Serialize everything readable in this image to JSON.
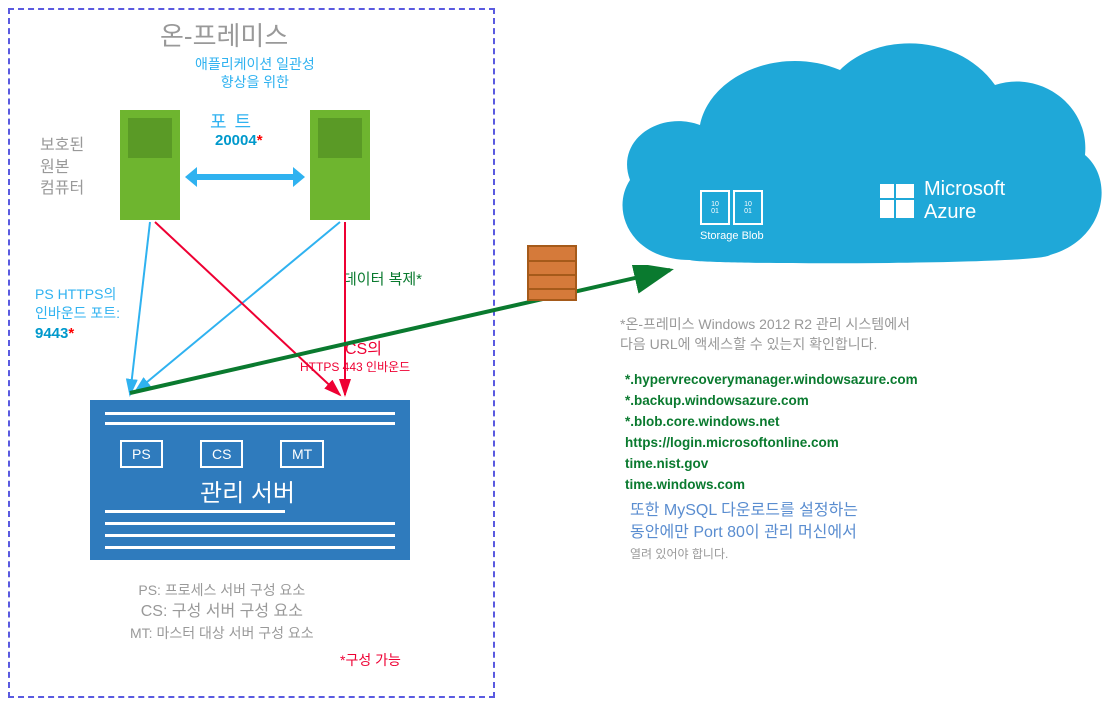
{
  "onprem": {
    "title": "온-프레미스",
    "app_consistency_l1": "애플리케이션 일관성",
    "app_consistency_l2": "향상을 위한",
    "port_label": "포트",
    "port_num": "20004",
    "protected_l1": "보호된",
    "protected_l2": "원본",
    "protected_l3": "컴퓨터",
    "ps_https_l1": "PS HTTPS의",
    "ps_https_l2": "인바운드 포트:",
    "ps_port": "9443",
    "cs_label": "CS의",
    "cs_sub": "HTTPS 443 인바운드",
    "data_replication": "데이터 복제*"
  },
  "mgmt": {
    "ps": "PS",
    "cs": "CS",
    "mt": "MT",
    "title": "관리 서버"
  },
  "legend": {
    "ps": "PS: 프로세스 서버 구성 요소",
    "cs": "CS: 구성 서버 구성 요소",
    "mt": "MT: 마스터 대상 서버 구성 요소",
    "config": "*구성 가능"
  },
  "azure": {
    "storage": "Storage Blob",
    "brand_l1": "Microsoft",
    "brand_l2": "Azure"
  },
  "req": {
    "l1": "*온-프레미스 Windows  2012  R2 관리 시스템에서",
    "l2": "다음 URL에 액세스할 수 있는지 확인합니다."
  },
  "urls": {
    "u1": "*.hypervrecoverymanager.windowsazure.com",
    "u2": "*.backup.windowsazure.com",
    "u3": "*.blob.core.windows.net",
    "u4": "https://login.microsoftonline.com",
    "u5": "time.nist.gov",
    "u6": "time.windows.com"
  },
  "mysql": {
    "l1": "또한 MySQL 다운로드를 설정하는",
    "l2": "동안에만 Port 80이 관리 머신에서",
    "small": "열려 있어야 합니다."
  }
}
